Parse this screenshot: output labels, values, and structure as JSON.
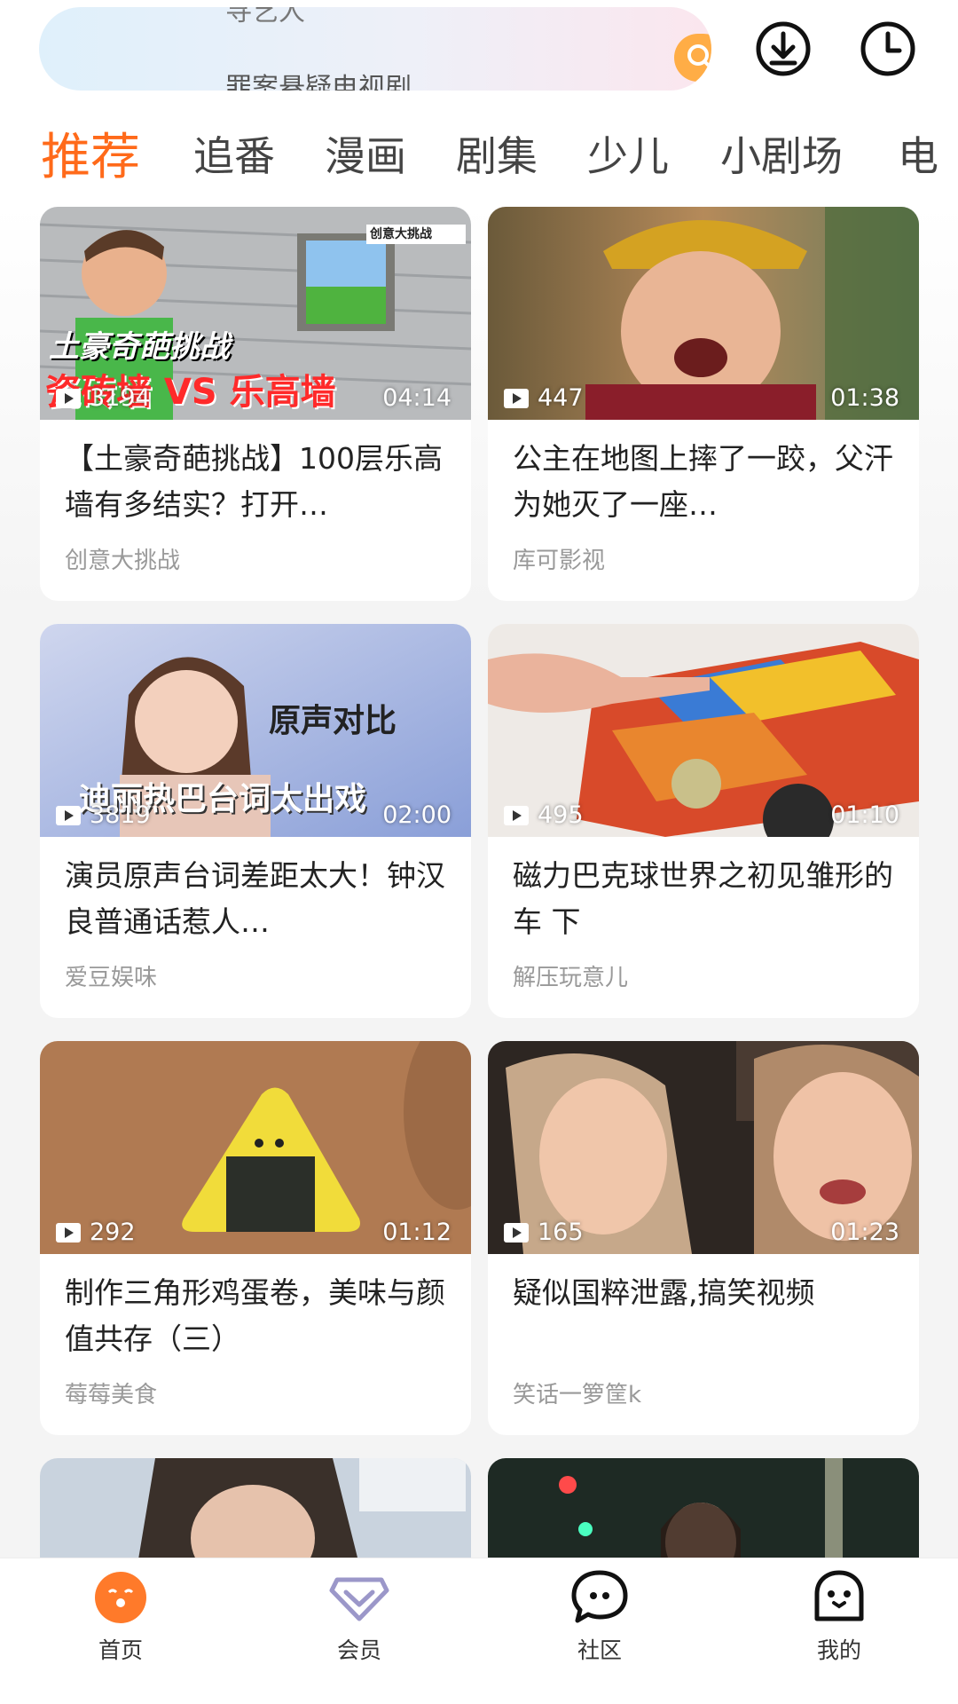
{
  "search": {
    "hint_top": "寻艺人",
    "hint": "罪案悬疑电视剧"
  },
  "header_icons": [
    "download-icon",
    "history-clock-icon"
  ],
  "tabs": [
    {
      "label": "推荐",
      "active": true
    },
    {
      "label": "追番"
    },
    {
      "label": "漫画"
    },
    {
      "label": "剧集"
    },
    {
      "label": "少儿"
    },
    {
      "label": "小剧场"
    },
    {
      "label": "电"
    }
  ],
  "cards": [
    {
      "plays": "3194",
      "duration": "04:14",
      "title": "【土豪奇葩挑战】100层乐高墙有多结实？打开…",
      "author": "创意大挑战",
      "overlay": {
        "tag": "创意大挑战",
        "line1": "土豪奇葩挑战",
        "line2": "瓷砖墙 VS 乐高墙"
      }
    },
    {
      "plays": "447",
      "duration": "01:38",
      "title": "公主在地图上摔了一跤，父汗为她灭了一座…",
      "author": "库可影视"
    },
    {
      "plays": "3819",
      "duration": "02:00",
      "title": "演员原声台词差距太大！钟汉良普通话惹人…",
      "author": "爱豆娱味",
      "overlay": {
        "line1": "原声对比",
        "line2": "迪丽热巴台词太出戏"
      }
    },
    {
      "plays": "495",
      "duration": "01:10",
      "title": "磁力巴克球世界之初见雏形的车 下",
      "author": "解压玩意儿"
    },
    {
      "plays": "292",
      "duration": "01:12",
      "title": "制作三角形鸡蛋卷，美味与颜值共存（三）",
      "author": "莓莓美食"
    },
    {
      "plays": "165",
      "duration": "01:23",
      "title": "疑似国粹泄露,搞笑视频",
      "author": "笑话一箩筐k"
    }
  ],
  "bottom_nav": [
    {
      "label": "首页",
      "icon": "home-face-icon",
      "active": true
    },
    {
      "label": "会员",
      "icon": "vip-diamond-icon"
    },
    {
      "label": "社区",
      "icon": "community-chat-icon"
    },
    {
      "label": "我的",
      "icon": "profile-ghost-icon"
    }
  ],
  "colors": {
    "accent": "#ff6a1a",
    "search_button": "#ffad46"
  }
}
